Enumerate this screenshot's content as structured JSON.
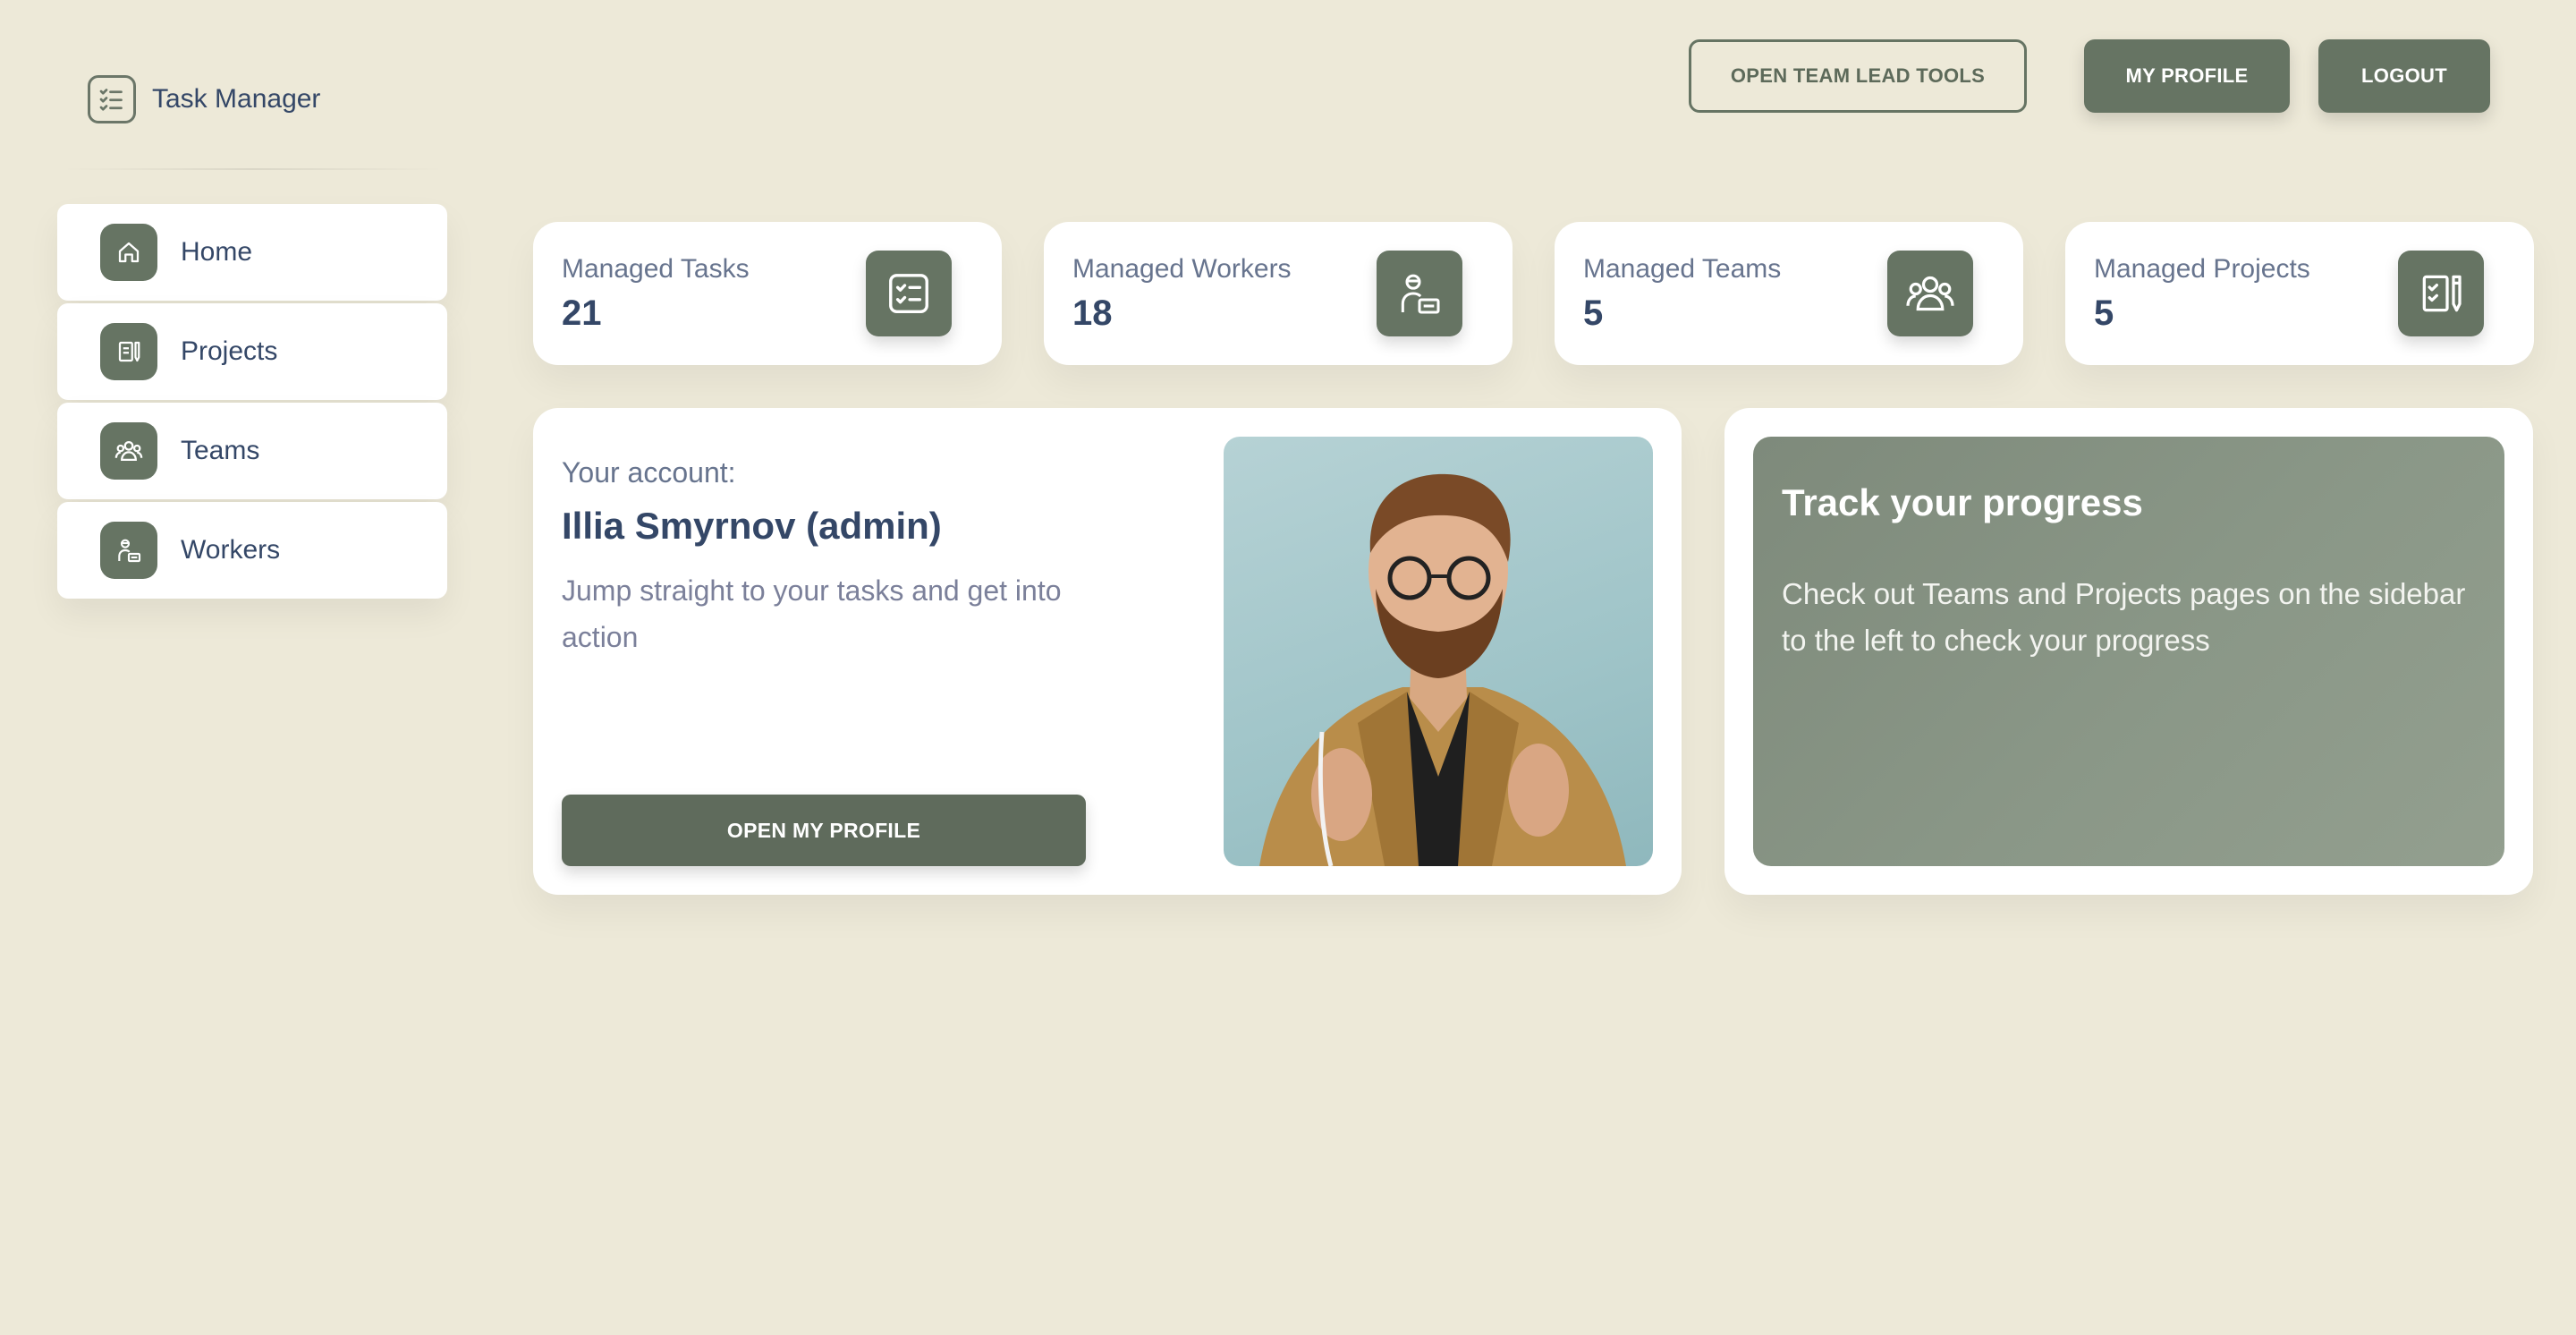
{
  "app": {
    "title": "Task Manager",
    "logo_icon": "checklist-icon"
  },
  "sidebar": {
    "items": [
      {
        "label": "Home",
        "icon": "home-icon"
      },
      {
        "label": "Projects",
        "icon": "projects-icon"
      },
      {
        "label": "Teams",
        "icon": "teams-icon"
      },
      {
        "label": "Workers",
        "icon": "worker-icon"
      }
    ]
  },
  "header": {
    "team_lead_button": "OPEN TEAM LEAD TOOLS",
    "profile_button": "MY PROFILE",
    "logout_button": "LOGOUT"
  },
  "stats": [
    {
      "label": "Managed Tasks",
      "value": "21",
      "icon": "tasks-icon"
    },
    {
      "label": "Managed Workers",
      "value": "18",
      "icon": "worker-icon"
    },
    {
      "label": "Managed Teams",
      "value": "5",
      "icon": "teams-icon"
    },
    {
      "label": "Managed Projects",
      "value": "5",
      "icon": "projects-icon"
    }
  ],
  "account": {
    "kicker": "Your account:",
    "name": "Illia Smyrnov (admin)",
    "description": "Jump straight to your tasks and get into action",
    "button": "OPEN MY PROFILE"
  },
  "progress": {
    "title": "Track your progress",
    "text": "Check out Teams and Projects pages on the sidebar to the left to check your progress"
  },
  "colors": {
    "background": "#ede9d8",
    "accent": "#667463",
    "text_dark": "#344767",
    "text_muted": "#67748e"
  }
}
